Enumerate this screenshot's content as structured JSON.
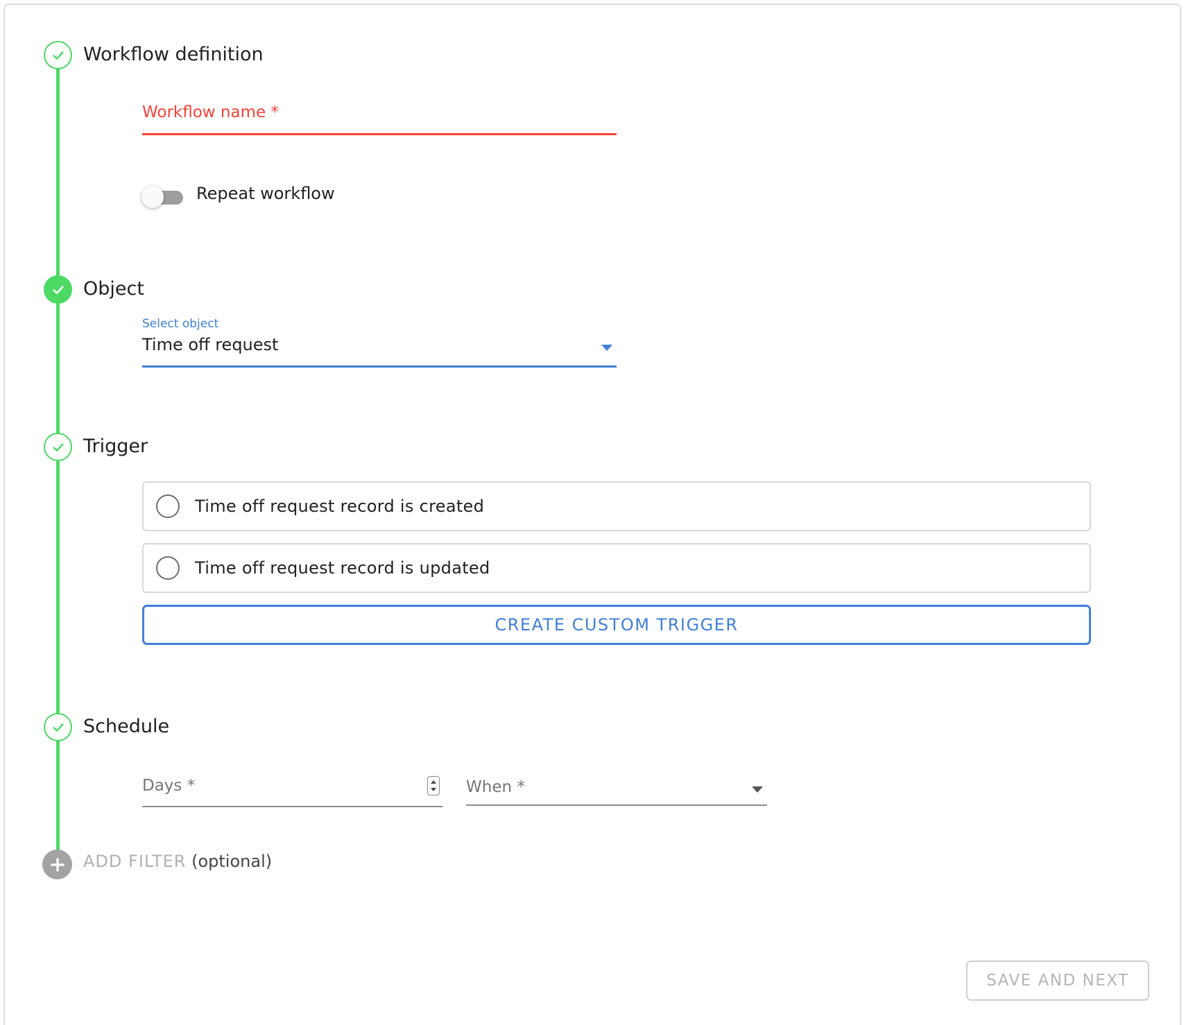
{
  "steps": {
    "definition": {
      "title": "Workflow definition",
      "state": "complete"
    },
    "object": {
      "title": "Object",
      "state": "active"
    },
    "trigger": {
      "title": "Trigger",
      "state": "complete"
    },
    "schedule": {
      "title": "Schedule",
      "state": "complete"
    }
  },
  "workflow_name": {
    "label": "Workflow name *",
    "value": "",
    "error": true
  },
  "repeat": {
    "label": "Repeat workflow",
    "checked": false
  },
  "object_select": {
    "label": "Select object",
    "value": "Time off request"
  },
  "triggers": [
    {
      "label": "Time off request record is created",
      "selected": false
    },
    {
      "label": "Time off request record is updated",
      "selected": false
    }
  ],
  "custom_trigger_label": "CREATE CUSTOM TRIGGER",
  "schedule_fields": {
    "days_label": "Days *",
    "when_label": "When *"
  },
  "add_filter": {
    "label": "ADD FILTER",
    "optional": "(optional)"
  },
  "save_label": "SAVE AND NEXT",
  "colors": {
    "accent_green": "#4cd964",
    "primary_blue": "#3f7fd9",
    "error_red": "#f44336",
    "disabled_gray": "#b5b5b5"
  },
  "icons": {
    "step_check": "check-icon",
    "add_filter": "plus-icon",
    "dropdown": "caret-down-icon",
    "spinner": "number-spinner-icon"
  }
}
